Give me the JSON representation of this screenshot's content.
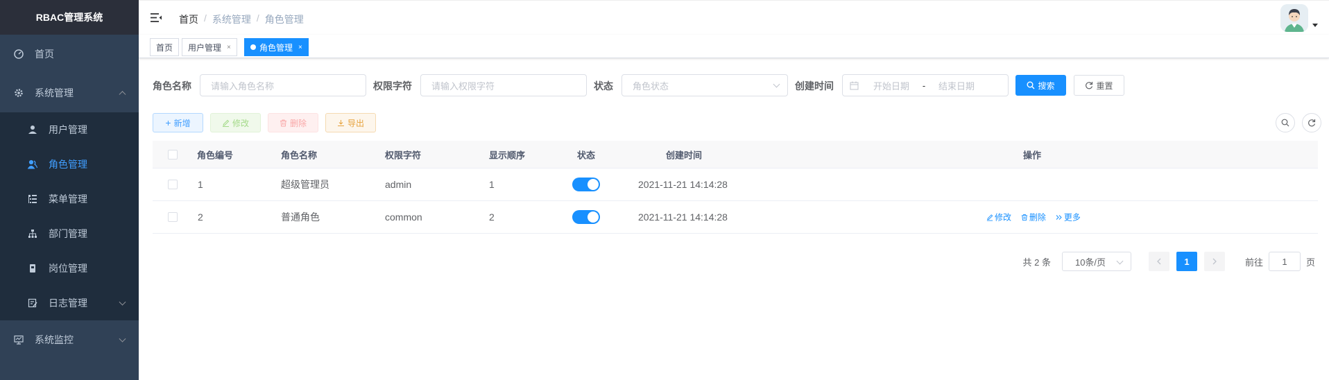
{
  "app": {
    "title": "RBAC管理系统"
  },
  "sidebar": {
    "items": [
      {
        "label": "首页"
      },
      {
        "label": "系统管理"
      },
      {
        "label": "系统监控"
      }
    ],
    "sub": [
      {
        "label": "用户管理"
      },
      {
        "label": "角色管理"
      },
      {
        "label": "菜单管理"
      },
      {
        "label": "部门管理"
      },
      {
        "label": "岗位管理"
      },
      {
        "label": "日志管理"
      }
    ]
  },
  "breadcrumb": [
    "首页",
    "/",
    "系统管理",
    "/",
    "角色管理"
  ],
  "tags": [
    {
      "label": "首页"
    },
    {
      "label": "用户管理",
      "close": "×"
    },
    {
      "label": "角色管理",
      "close": "×"
    }
  ],
  "search": {
    "role_name_label": "角色名称",
    "role_name_placeholder": "请输入角色名称",
    "role_key_label": "权限字符",
    "role_key_placeholder": "请输入权限字符",
    "status_label": "状态",
    "status_placeholder": "角色状态",
    "created_label": "创建时间",
    "start_placeholder": "开始日期",
    "range_sep": "-",
    "end_placeholder": "结束日期",
    "search_btn": "搜索",
    "reset_btn": "重置"
  },
  "toolbar": {
    "add": "新增",
    "edit": "修改",
    "delete": "删除",
    "export": "导出"
  },
  "table": {
    "headers": [
      "角色编号",
      "角色名称",
      "权限字符",
      "显示顺序",
      "状态",
      "创建时间",
      "操作"
    ],
    "rows": [
      {
        "id": "1",
        "name": "超级管理员",
        "key": "admin",
        "sort": "1",
        "status": true,
        "created": "2021-11-21 14:14:28",
        "ops": []
      },
      {
        "id": "2",
        "name": "普通角色",
        "key": "common",
        "sort": "2",
        "status": true,
        "created": "2021-11-21 14:14:28",
        "ops": [
          "修改",
          "删除",
          "更多"
        ]
      }
    ]
  },
  "pagination": {
    "total": "共 2 条",
    "size": "10条/页",
    "current": "1",
    "goto_prefix": "前往",
    "goto_value": "1",
    "goto_suffix": "页"
  },
  "colors": {
    "primary": "#1890ff",
    "sidebar": "#304156",
    "submenu": "#1f2d3d"
  }
}
